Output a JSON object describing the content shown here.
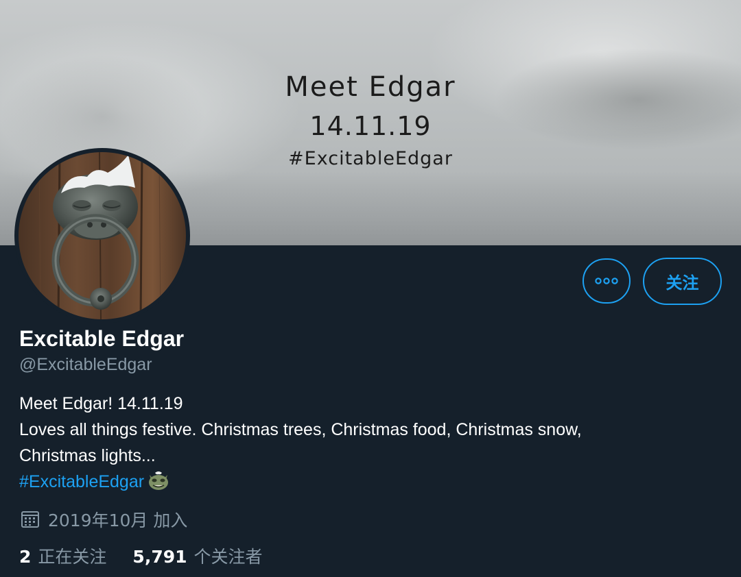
{
  "banner": {
    "line1": "Meet Edgar",
    "line2": "14.11.19",
    "line3": "#ExcitableEdgar"
  },
  "profile": {
    "display_name": "Excitable Edgar",
    "handle": "@ExcitableEdgar",
    "bio_lines": [
      "Meet Edgar! 14.11.19",
      "Loves all things festive. Christmas trees, Christmas food, Christmas snow,",
      "Christmas lights..."
    ],
    "bio_hashtag": "#ExcitableEdgar",
    "joined": "2019年10月 加入"
  },
  "actions": {
    "more_icon": "more-horizontal-icon",
    "follow_label": "关注"
  },
  "stats": {
    "following_count": "2",
    "following_label": "正在关注",
    "followers_count": "5,791",
    "followers_label": "个关注者"
  },
  "colors": {
    "background": "#15202b",
    "accent": "#1da1f2",
    "secondary_text": "#8899a6",
    "primary_text": "#ffffff"
  }
}
